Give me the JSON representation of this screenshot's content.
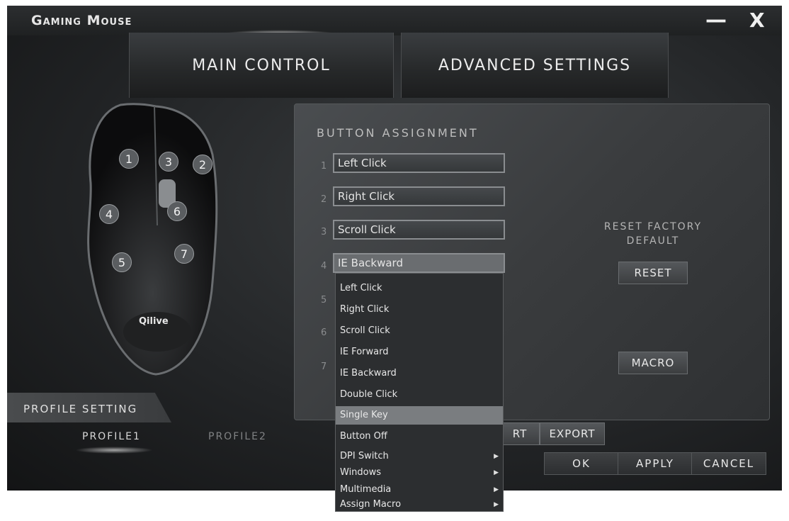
{
  "window": {
    "title": "Gaming Mouse",
    "minimize": "—",
    "close": "X"
  },
  "tabs": [
    {
      "label": "MAIN CONTROL"
    },
    {
      "label": "ADVANCED SETTINGS"
    }
  ],
  "mouse": {
    "brand": "Qilive",
    "buttons": [
      "1",
      "3",
      "2",
      "4",
      "6",
      "5",
      "7"
    ]
  },
  "assignment": {
    "title": "BUTTON ASSIGNMENT",
    "rows": [
      {
        "num": "1",
        "value": "Left Click"
      },
      {
        "num": "2",
        "value": "Right Click"
      },
      {
        "num": "3",
        "value": "Scroll Click"
      },
      {
        "num": "4",
        "value": "IE Backward"
      },
      {
        "num": "5",
        "value": ""
      },
      {
        "num": "6",
        "value": ""
      },
      {
        "num": "7",
        "value": ""
      }
    ]
  },
  "dropdown": {
    "items": [
      {
        "label": "Left Click",
        "submenu": false
      },
      {
        "label": "Right Click",
        "submenu": false
      },
      {
        "label": "Scroll Click",
        "submenu": false
      },
      {
        "label": "IE Forward",
        "submenu": false
      },
      {
        "label": "IE Backward",
        "submenu": false
      },
      {
        "label": "Double Click",
        "submenu": false
      },
      {
        "label": "Single Key",
        "submenu": false,
        "highlighted": true
      },
      {
        "label": "Button Off",
        "submenu": false
      },
      {
        "label": "DPI Switch",
        "submenu": true
      },
      {
        "label": "Windows",
        "submenu": true
      },
      {
        "label": "Multimedia",
        "submenu": true
      },
      {
        "label": "Assign Macro",
        "submenu": true
      }
    ],
    "arrow": "▶"
  },
  "reset": {
    "label_line1": "RESET FACTORY",
    "label_line2": "DEFAULT",
    "button": "RESET"
  },
  "macro": {
    "button": "MACRO"
  },
  "profile": {
    "title": "PROFILE SETTING",
    "tabs": [
      "PROFILE1",
      "PROFILE2"
    ]
  },
  "file_buttons": {
    "import": "RT",
    "export": "EXPORT"
  },
  "actions": {
    "ok": "OK",
    "apply": "APPLY",
    "cancel": "CANCEL"
  }
}
